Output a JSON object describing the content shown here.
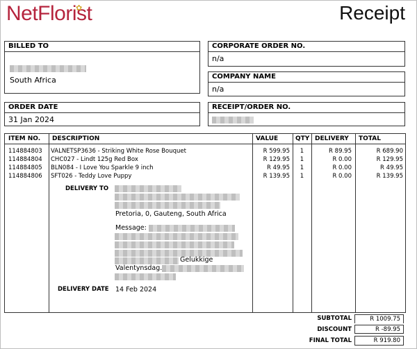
{
  "header": {
    "logo_text": "NetFlorist",
    "logo_icon": "flower-icon",
    "title": "Receipt"
  },
  "billed_to": {
    "label": "BILLED TO",
    "country": "South Africa"
  },
  "corporate_order": {
    "label": "CORPORATE ORDER NO.",
    "value": "n/a"
  },
  "company_name": {
    "label": "COMPANY NAME",
    "value": "n/a"
  },
  "order_date": {
    "label": "ORDER DATE",
    "value": "31 Jan 2024"
  },
  "receipt_no": {
    "label": "RECEIPT/ORDER NO."
  },
  "table": {
    "headers": [
      "ITEM NO.",
      "DESCRIPTION",
      "VALUE",
      "QTY",
      "DELIVERY",
      "TOTAL"
    ],
    "rows": [
      {
        "item": "114884803",
        "desc": "VALNETSP3636 - Striking White Rose Bouquet",
        "value": "R 599.95",
        "qty": "1",
        "delivery": "R 89.95",
        "total": "R 689.90"
      },
      {
        "item": "114884804",
        "desc": "CHC027 - Lindt 125g Red Box",
        "value": "R 129.95",
        "qty": "1",
        "delivery": "R 0.00",
        "total": "R 129.95"
      },
      {
        "item": "114884805",
        "desc": "BLN084 - I Love You Sparkle 9 inch",
        "value": "R 49.95",
        "qty": "1",
        "delivery": "R 0.00",
        "total": "R 49.95"
      },
      {
        "item": "114884806",
        "desc": "SFT026 - Teddy Love Puppy",
        "value": "R 139.95",
        "qty": "1",
        "delivery": "R 0.00",
        "total": "R 139.95"
      }
    ]
  },
  "delivery": {
    "to_label": "DELIVERY TO",
    "address_line": "Pretoria, 0, Gauteng, South Africa",
    "message_label": "Message:",
    "message_part1": "Gelukkige",
    "message_part2": "Valentynsdag.",
    "date_label": "DELIVERY DATE",
    "date_value": "14 Feb 2024"
  },
  "totals": {
    "subtotal_label": "SUBTOTAL",
    "subtotal_value": "R 1009.75",
    "discount_label": "DISCOUNT",
    "discount_value": "R -89.95",
    "final_label": "FINAL TOTAL",
    "final_value": "R 919.80"
  }
}
